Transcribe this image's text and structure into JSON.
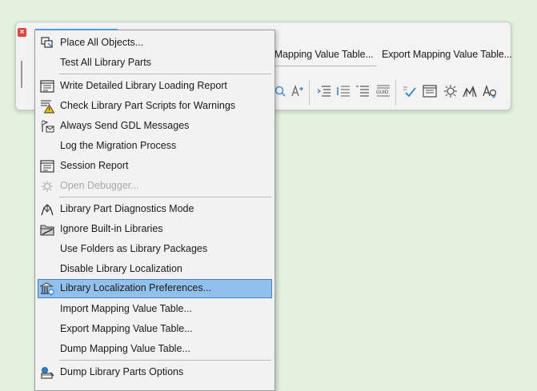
{
  "palette": {
    "close_glyph": "×",
    "import_mapping_label": "t Mapping Value Table...",
    "export_mapping_label": "Export Mapping Value Table...",
    "icons": [
      "search-icon",
      "replace-icon",
      "indent-icon",
      "align-list-icon",
      "list-icon",
      "guid-icon",
      "check-script-icon",
      "session-report-icon",
      "debugger-icon",
      "diagnostics-icon",
      "translate-icon"
    ]
  },
  "menu": {
    "items": [
      {
        "label": "Place All Objects...",
        "icon": "place-objects-icon"
      },
      {
        "label": "Test All Library Parts",
        "icon": ""
      },
      {
        "label": "Write Detailed Library Loading Report",
        "icon": "report-list-icon"
      },
      {
        "label": "Check Library Part Scripts for Warnings",
        "icon": "warning-script-icon"
      },
      {
        "label": "Always Send GDL Messages",
        "icon": "gdl-message-icon"
      },
      {
        "label": "Log the Migration Process",
        "icon": ""
      },
      {
        "label": "Session Report",
        "icon": "session-report-icon"
      },
      {
        "label": "Open Debugger...",
        "icon": "debugger-icon",
        "disabled": true
      },
      {
        "label": "Library Part Diagnostics Mode",
        "icon": "diagnostics-icon"
      },
      {
        "label": "Ignore Built-in Libraries",
        "icon": "folder-icon"
      },
      {
        "label": "Use Folders as Library Packages",
        "icon": ""
      },
      {
        "label": "Disable Library Localization",
        "icon": ""
      },
      {
        "label": "Library Localization Preferences...",
        "icon": "localization-icon",
        "highlighted": true
      },
      {
        "label": "Import Mapping Value Table...",
        "icon": ""
      },
      {
        "label": "Export Mapping Value Table...",
        "icon": ""
      },
      {
        "label": "Dump Mapping Value Table...",
        "icon": ""
      },
      {
        "label": "Dump Library Parts Options",
        "icon": "dump-options-icon"
      }
    ]
  },
  "colors": {
    "desktop": "#e2f2de",
    "highlight": "#92c0ec",
    "highlight_border": "#3f7fc4",
    "warning": "#f2c200",
    "accent_blue": "#2f7fd1"
  }
}
